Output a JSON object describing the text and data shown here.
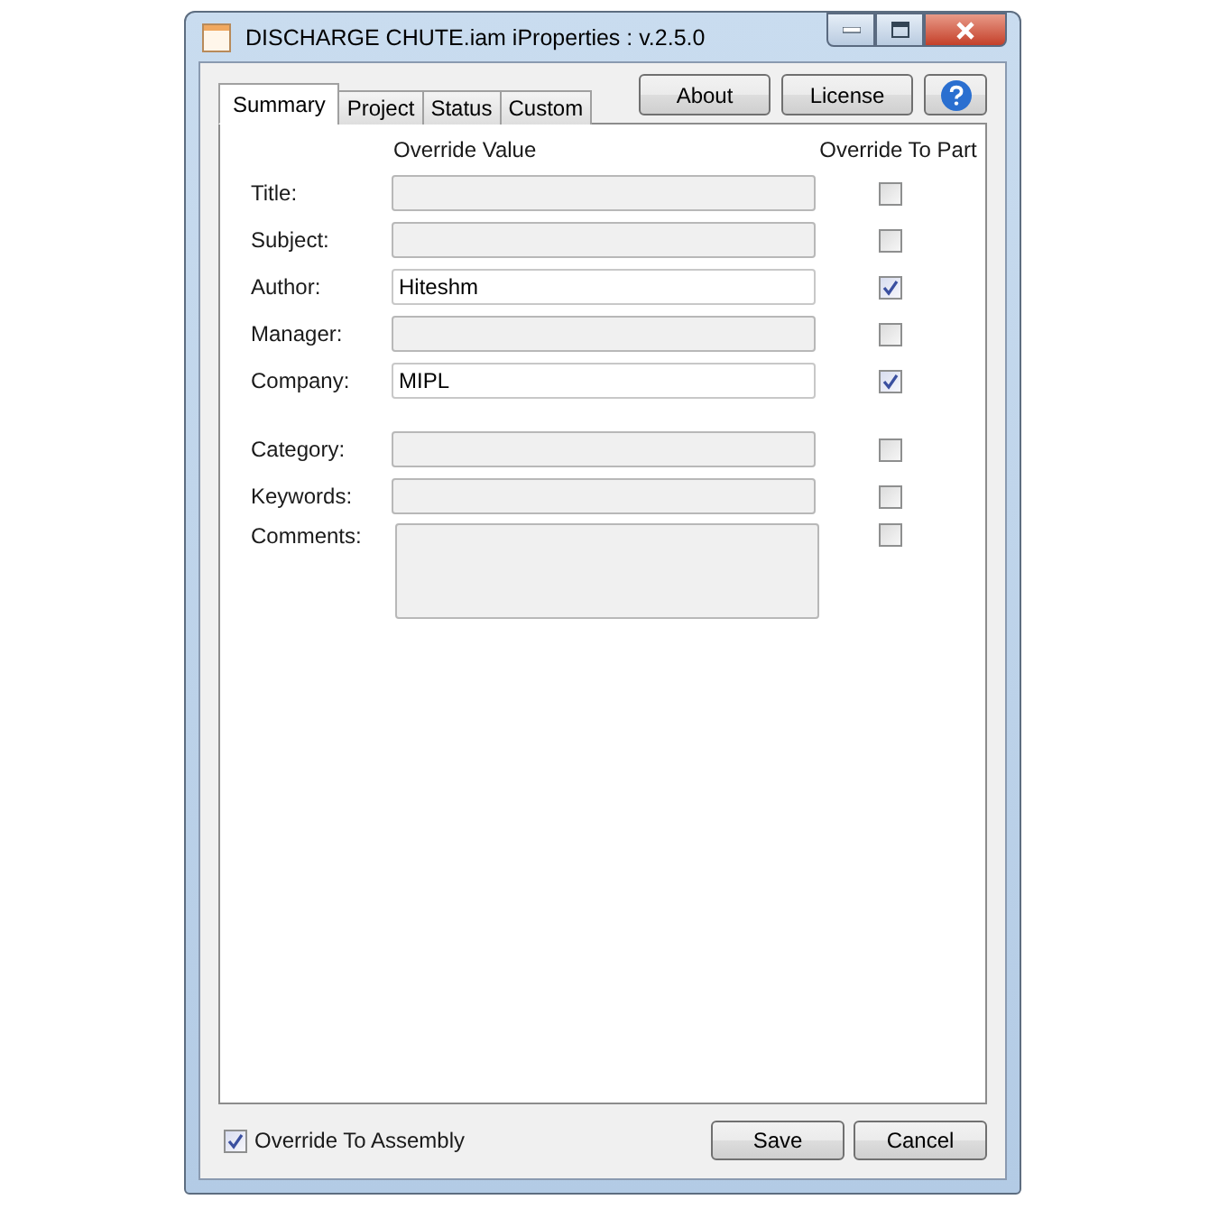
{
  "window": {
    "title": "DISCHARGE CHUTE.iam iProperties : v.2.5.0"
  },
  "tabs": [
    {
      "label": "Summary",
      "selected": true
    },
    {
      "label": "Project",
      "selected": false
    },
    {
      "label": "Status",
      "selected": false
    },
    {
      "label": "Custom",
      "selected": false
    }
  ],
  "header_buttons": [
    {
      "label": "About"
    },
    {
      "label": "License"
    }
  ],
  "columns": {
    "value": "Override Value",
    "override": "Override To Part"
  },
  "field_groups": [
    [
      {
        "label": "Title:",
        "disabled": true,
        "override": false,
        "kind": "line"
      },
      {
        "label": "Subject:",
        "disabled": true,
        "override": false,
        "kind": "line"
      },
      {
        "label": "Author:",
        "value": "Hiteshm",
        "disabled": false,
        "override": true,
        "kind": "line"
      },
      {
        "label": "Manager:",
        "disabled": true,
        "override": false,
        "kind": "line"
      },
      {
        "label": "Company:",
        "value": "MIPL",
        "disabled": false,
        "override": true,
        "kind": "line"
      }
    ],
    [
      {
        "label": "Category:",
        "disabled": true,
        "override": false,
        "kind": "line"
      },
      {
        "label": "Keywords:",
        "disabled": true,
        "override": false,
        "kind": "line"
      },
      {
        "label": "Comments:",
        "disabled": true,
        "override": false,
        "kind": "area"
      }
    ]
  ],
  "assembly": {
    "label": "Override To Assembly",
    "checked": true
  },
  "footer_buttons": [
    {
      "label": "Save"
    },
    {
      "label": "Cancel"
    }
  ]
}
